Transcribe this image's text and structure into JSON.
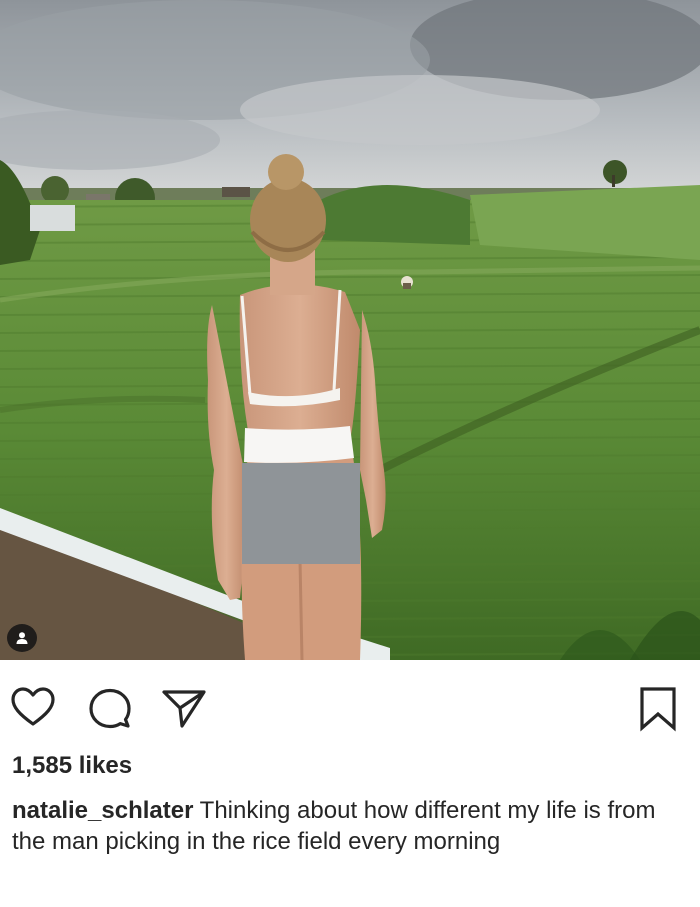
{
  "post": {
    "icons": {
      "like": "heart-icon",
      "comment": "comment-bubble-icon",
      "share": "paper-plane-icon",
      "save": "bookmark-icon",
      "tag": "user-tag-icon"
    },
    "likes_text": "1,585 likes",
    "caption": {
      "username": "natalie_schlater",
      "text": "Thinking about how different my life is from the man picking in the rice field every morning"
    },
    "colors": {
      "text": "#262626",
      "censor": "#8f9498"
    }
  }
}
